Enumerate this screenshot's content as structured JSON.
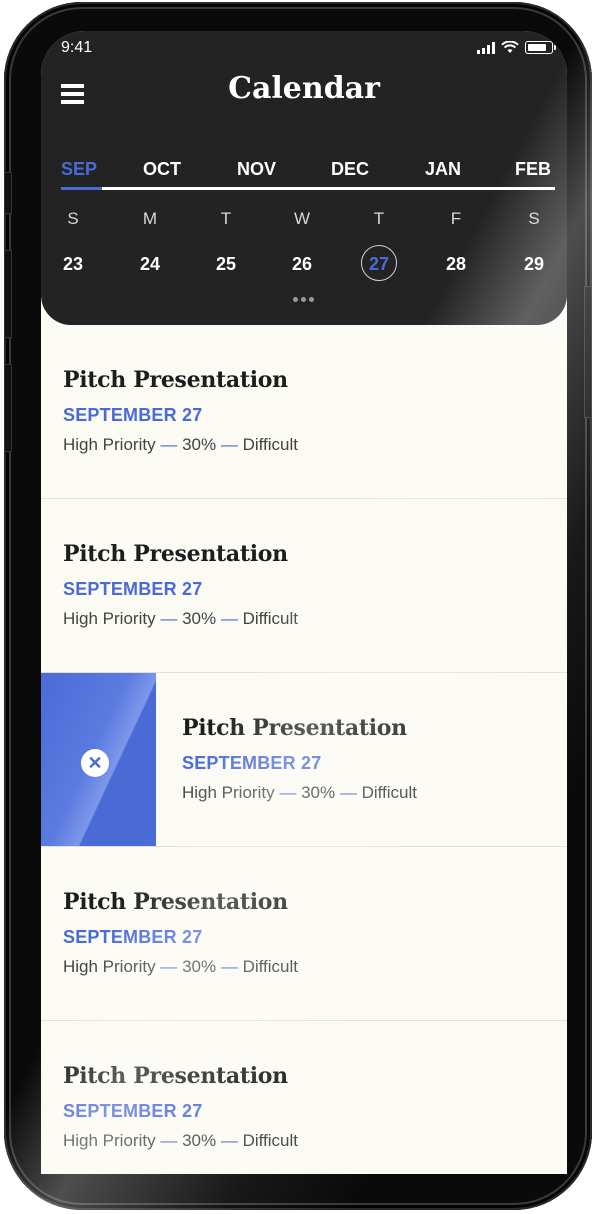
{
  "status_bar": {
    "time": "9:41"
  },
  "header": {
    "title": "Calendar"
  },
  "months": [
    "SEP",
    "OCT",
    "NOV",
    "DEC",
    "JAN",
    "FEB"
  ],
  "active_month": "SEP",
  "weekdays": [
    "S",
    "M",
    "T",
    "W",
    "T",
    "F",
    "S"
  ],
  "dates": [
    "23",
    "24",
    "25",
    "26",
    "27",
    "28",
    "29"
  ],
  "selected_date": "27",
  "events": [
    {
      "title": "Pitch Presentation",
      "date": "SEPTEMBER 27",
      "priority": "High Priority",
      "percent": "30%",
      "difficulty": "Difficult",
      "sep": "—"
    },
    {
      "title": "Pitch Presentation",
      "date": "SEPTEMBER 27",
      "priority": "High Priority",
      "percent": "30%",
      "difficulty": "Difficult",
      "sep": "—"
    },
    {
      "title": "Pitch Presentation",
      "date": "SEPTEMBER 27",
      "priority": "High Priority",
      "percent": "30%",
      "difficulty": "Difficult",
      "sep": "—"
    },
    {
      "title": "Pitch Presentation",
      "date": "SEPTEMBER 27",
      "priority": "High Priority",
      "percent": "30%",
      "difficulty": "Difficult",
      "sep": "—"
    },
    {
      "title": "Pitch Presentation",
      "date": "SEPTEMBER 27",
      "priority": "High Priority",
      "percent": "30%",
      "difficulty": "Difficult",
      "sep": "—"
    }
  ],
  "swiped_event_index": 2,
  "icons": {
    "menu": "hamburger-menu-icon",
    "delete": "close-circle-icon",
    "signal": "cellular-signal-icon",
    "wifi": "wifi-icon",
    "battery": "battery-icon"
  },
  "colors": {
    "accent": "#4a6bd6",
    "header_bg": "#232323",
    "list_bg": "#fbfaf3"
  }
}
